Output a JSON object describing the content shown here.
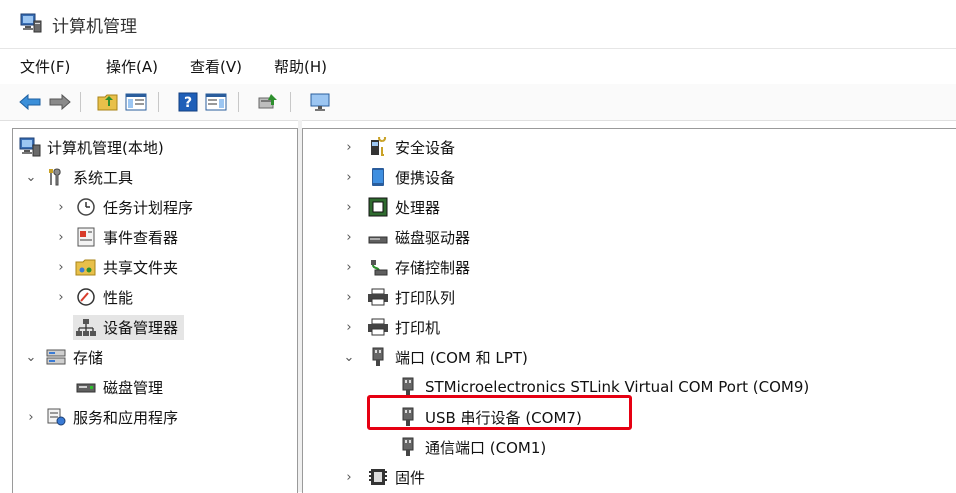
{
  "window": {
    "title": "计算机管理"
  },
  "menu": [
    {
      "id": "file",
      "label": "文件(F)"
    },
    {
      "id": "action",
      "label": "操作(A)"
    },
    {
      "id": "view",
      "label": "查看(V)"
    },
    {
      "id": "help",
      "label": "帮助(H)"
    }
  ],
  "tree": {
    "root": "计算机管理(本地)",
    "system_tools": "系统工具",
    "task_scheduler": "任务计划程序",
    "event_viewer": "事件查看器",
    "shared_folders": "共享文件夹",
    "performance": "性能",
    "device_manager": "设备管理器",
    "storage": "存储",
    "disk_management": "磁盘管理",
    "services_apps": "服务和应用程序"
  },
  "devices": {
    "security": "安全设备",
    "portable": "便携设备",
    "processors": "处理器",
    "disk_drives": "磁盘驱动器",
    "storage_controllers": "存储控制器",
    "print_queues": "打印队列",
    "printers": "打印机",
    "ports": "端口 (COM 和 LPT)",
    "port_stlink": "STMicroelectronics STLink Virtual COM Port (COM9)",
    "port_usb": "USB 串行设备 (COM7)",
    "port_comm": "通信端口 (COM1)",
    "firmware": "固件"
  },
  "colors": {
    "highlight": "#e60012",
    "selected_bg": "#e5e5e5"
  }
}
